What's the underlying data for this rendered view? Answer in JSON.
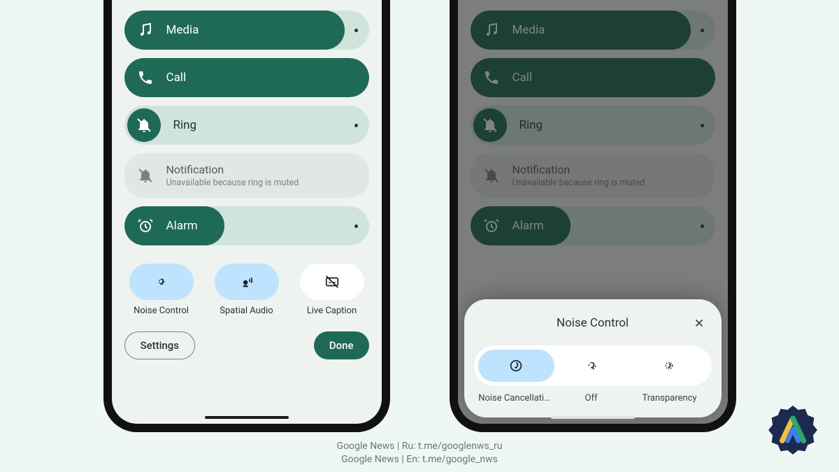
{
  "sound_panel": {
    "sliders": [
      {
        "key": "media",
        "label": "Media",
        "icon": "music-note-icon",
        "fill_pct": 90,
        "has_dot": true,
        "style": "full"
      },
      {
        "key": "call",
        "label": "Call",
        "icon": "phone-icon",
        "fill_pct": 100,
        "has_dot": false,
        "style": "full"
      },
      {
        "key": "ring",
        "label": "Ring",
        "icon": "bell-off-icon",
        "fill_pct": 0,
        "has_dot": true,
        "style": "ring"
      },
      {
        "key": "notification",
        "label": "Notification",
        "sublabel": "Unavailable because ring is muted",
        "icon": "notification-off-icon",
        "fill_pct": 0,
        "has_dot": false,
        "style": "notification"
      },
      {
        "key": "alarm",
        "label": "Alarm",
        "icon": "alarm-icon",
        "fill_pct": 41,
        "has_dot": true,
        "style": "alarm"
      }
    ],
    "chips": [
      {
        "label": "Noise Control",
        "icon": "ear-dots-icon",
        "active": true
      },
      {
        "label": "Spatial Audio",
        "icon": "spatial-audio-icon",
        "active": true
      },
      {
        "label": "Live Caption",
        "icon": "live-caption-off-icon",
        "active": false
      }
    ],
    "settings_label": "Settings",
    "done_label": "Done"
  },
  "noise_control_sheet": {
    "title": "Noise Control",
    "close": "Close",
    "options": [
      {
        "label": "Noise Cancellati…",
        "icon": "ear-circle-icon",
        "active": true
      },
      {
        "label": "Off",
        "icon": "ear-off-icon",
        "active": false
      },
      {
        "label": "Transparency",
        "icon": "ear-dots-icon",
        "active": false
      }
    ]
  },
  "credits": {
    "line1": "Google News | Ru: t.me/googlenws_ru",
    "line2": "Google News | En: t.me/google_nws"
  }
}
